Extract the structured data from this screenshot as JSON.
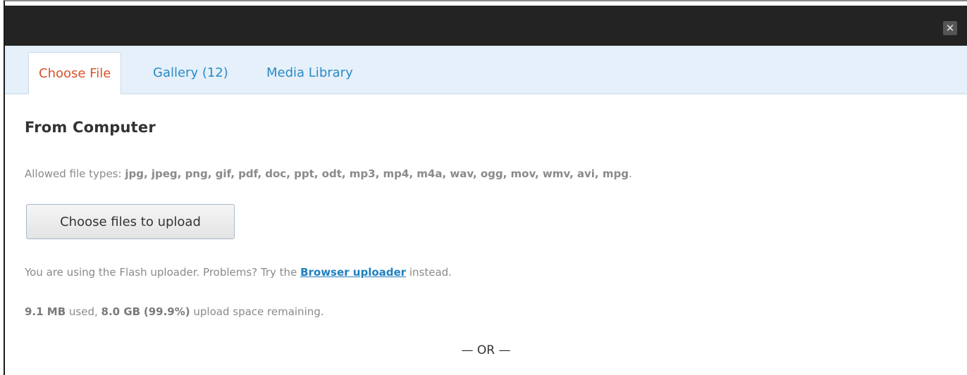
{
  "dialog": {
    "close_glyph": "✕"
  },
  "tabs": [
    {
      "label": "Choose File",
      "active": true
    },
    {
      "label": "Gallery (12)",
      "active": false
    },
    {
      "label": "Media Library",
      "active": false
    }
  ],
  "section": {
    "heading": "From Computer",
    "allowed_prefix": "Allowed file types: ",
    "allowed_types": "jpg, jpeg, png, gif, pdf, doc, ppt, odt, mp3, mp4, m4a, wav, ogg, mov, wmv, avi, mpg",
    "allowed_suffix": ".",
    "upload_button": "Choose files to upload",
    "flash_prefix": "You are using the Flash uploader. Problems? Try the ",
    "flash_link": "Browser uploader",
    "flash_suffix": " instead.",
    "used": "9.1 MB",
    "used_suffix": " used, ",
    "remaining": "8.0 GB",
    "remaining_space": " ",
    "percent": "(99.9%)",
    "remaining_suffix": " upload space remaining.",
    "or_separator": "— OR —"
  },
  "colors": {
    "titlebar": "#232323",
    "tabbar": "#e5f0fa",
    "active_tab_text": "#d5522b",
    "tab_link": "#2a8ac6"
  }
}
